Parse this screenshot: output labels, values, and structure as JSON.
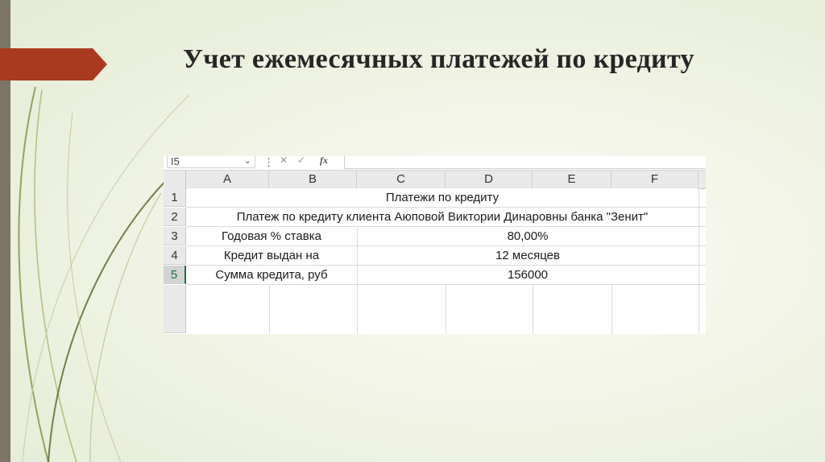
{
  "slide": {
    "title": "Учет ежемесячных платежей по кредиту"
  },
  "spreadsheet": {
    "name_box": "I5",
    "formula_bar_icon": "fx",
    "columns": [
      "A",
      "B",
      "C",
      "D",
      "E",
      "F"
    ],
    "row_numbers": [
      "1",
      "2",
      "3",
      "4",
      "5"
    ],
    "active_row": "5",
    "rows": [
      {
        "merged_text": "Платежи по кредиту"
      },
      {
        "merged_text": "Платеж по кредиту клиента Аюповой Виктории Динаровны банка \"Зенит\""
      },
      {
        "label": "Годовая % ставка",
        "value": "80,00%"
      },
      {
        "label": "Кредит выдан на",
        "value": "12 месяцев"
      },
      {
        "label": "Сумма кредита, руб",
        "value": "156000"
      }
    ]
  },
  "colors": {
    "accent_arrow": "#a93a20",
    "left_bar": "#7c7565",
    "active_row_marker": "#1e7145"
  }
}
